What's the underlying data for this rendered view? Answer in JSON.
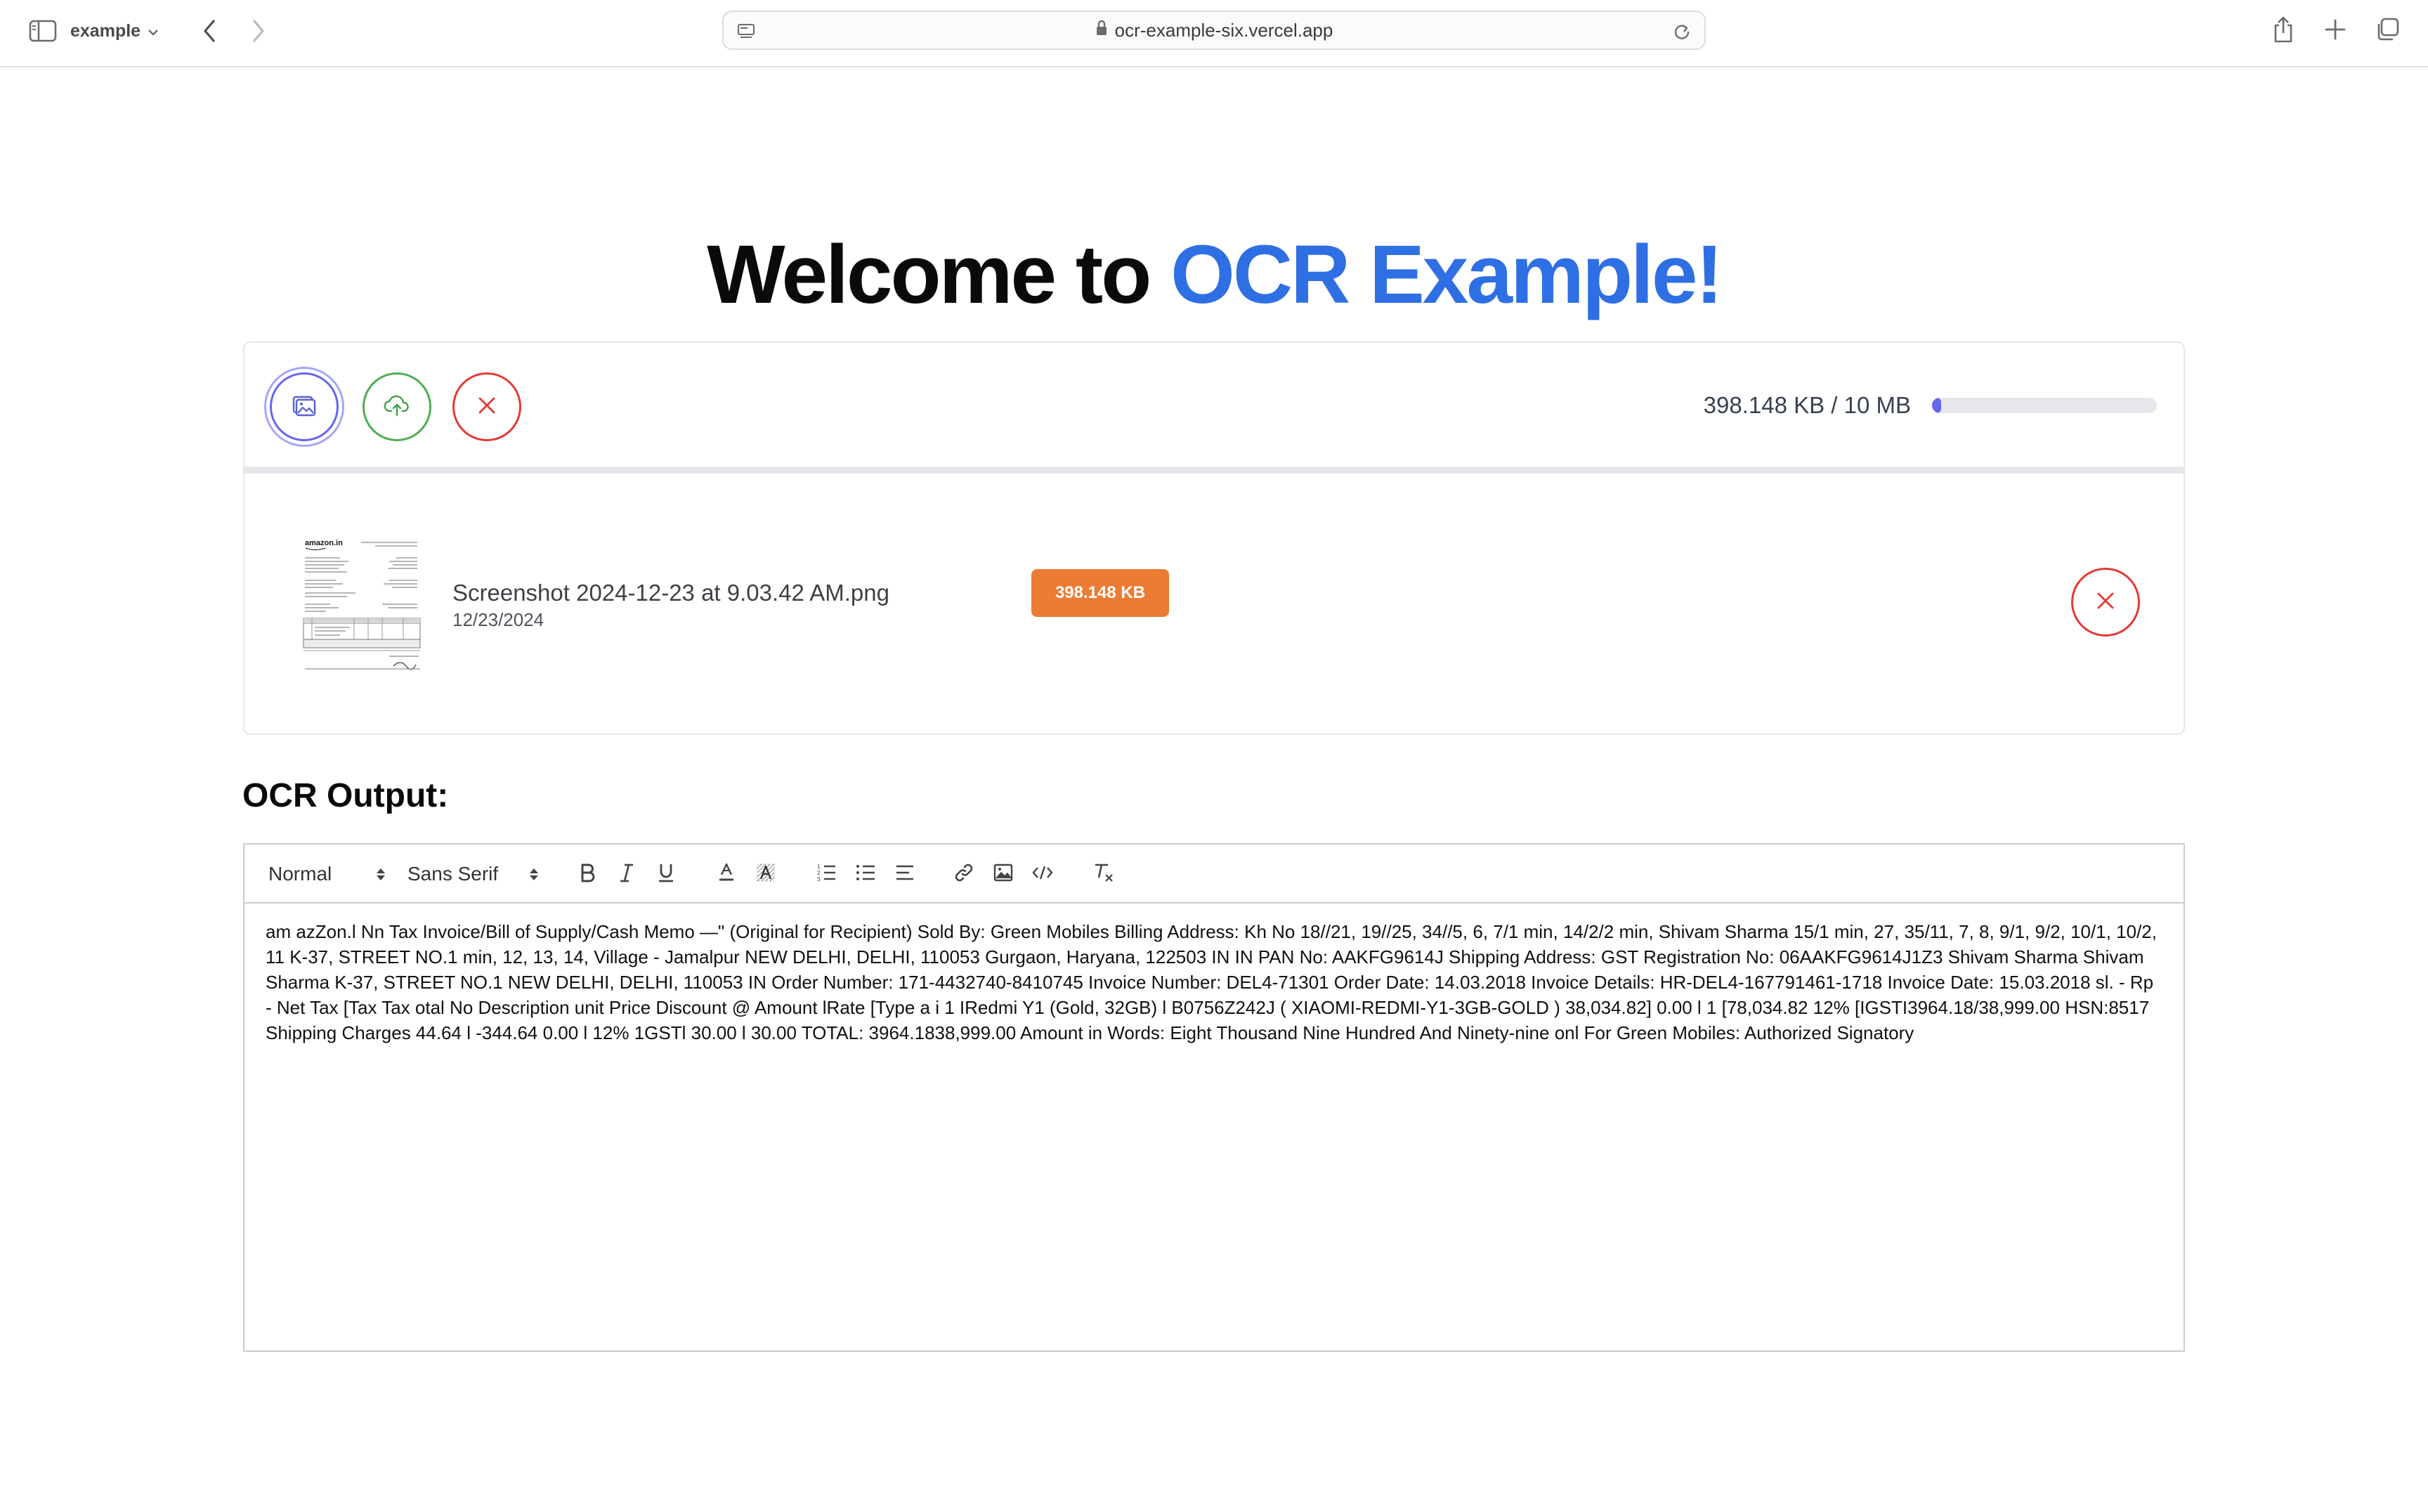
{
  "browser": {
    "tab_group_label": "example",
    "url": "ocr-example-six.vercel.app",
    "icons": {
      "sidebar": "sidebar-icon",
      "back": "chevron-left-icon",
      "forward": "chevron-right-icon",
      "lock": "lock-icon",
      "reload": "reload-icon",
      "share": "share-icon",
      "new_tab": "plus-icon",
      "tab_overview": "tabs-icon"
    }
  },
  "page": {
    "title_prefix": "Welcome to ",
    "title_accent": "OCR Example!",
    "accent_color": "#2f6fe4"
  },
  "uploader": {
    "size_summary": "398.148 KB / 10 MB",
    "usage_fraction": 0.039,
    "buttons": {
      "add_image_icon": "image-icon",
      "upload_icon": "cloud-upload-icon",
      "cancel_icon": "close-icon"
    },
    "files": [
      {
        "name": "Screenshot 2024-12-23 at 9.03.42 AM.png",
        "date": "12/23/2024",
        "size_badge": "398.148 KB",
        "badge_color": "#ec7c33",
        "thumbnail_brand": "amazon.in"
      }
    ]
  },
  "ocr": {
    "heading": "OCR Output:",
    "toolbar": {
      "header_select": "Normal",
      "font_select": "Sans Serif",
      "tools": [
        "bold",
        "italic",
        "underline",
        "color",
        "background",
        "ordered-list",
        "bullet-list",
        "align",
        "link",
        "image",
        "code-block",
        "clean"
      ]
    },
    "text": "am azZon.l Nn Tax Invoice/Bill of Supply/Cash Memo —\" (Original for Recipient) Sold By: Green Mobiles Billing Address: Kh No 18//21, 19//25, 34//5, 6, 7/1 min, 14/2/2 min, Shivam Sharma 15/1 min, 27, 35/11, 7, 8, 9/1, 9/2, 10/1, 10/2, 11 K-37, STREET NO.1 min, 12, 13, 14, Village - Jamalpur NEW DELHI, DELHI, 110053 Gurgaon, Haryana, 122503 IN IN PAN No: AAKFG9614J Shipping Address: GST Registration No: 06AAKFG9614J1Z3 Shivam Sharma Shivam Sharma K-37, STREET NO.1 NEW DELHI, DELHI, 110053 IN Order Number: 171-4432740-8410745 Invoice Number: DEL4-71301 Order Date: 14.03.2018 Invoice Details: HR-DEL4-167791461-1718 Invoice Date: 15.03.2018 sl. - Rp - Net Tax [Tax Tax otal No Description unit Price Discount @ Amount lRate [Type a i 1 IRedmi Y1 (Gold, 32GB) l B0756Z242J ( XIAOMI-REDMI-Y1-3GB-GOLD ) 38,034.82] 0.00 l 1 [78,034.82 12% [IGSTI3964.18/38,999.00 HSN:8517 Shipping Charges 44.64 l -344.64 0.00 l 12% 1GSTl 30.00 l 30.00 TOTAL: 3964.1838,999.00 Amount in Words: Eight Thousand Nine Hundred And Ninety-nine onl For Green Mobiles: Authorized Signatory"
  }
}
